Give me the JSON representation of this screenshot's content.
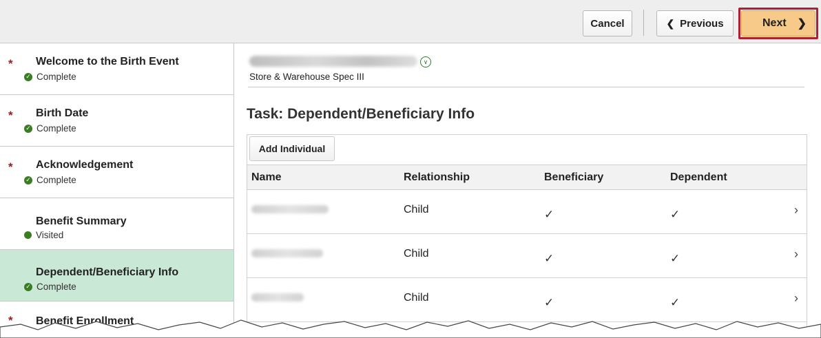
{
  "toolbar": {
    "cancel_label": "Cancel",
    "previous_label": "Previous",
    "next_label": "Next"
  },
  "sidebar": {
    "steps": [
      {
        "title": "Welcome to the Birth Event",
        "status": "Complete",
        "required": "*"
      },
      {
        "title": "Birth Date",
        "status": "Complete",
        "required": "*"
      },
      {
        "title": "Acknowledgement",
        "status": "Complete",
        "required": "*"
      },
      {
        "title": "Benefit Summary",
        "status": "Visited",
        "required": ""
      },
      {
        "title": "Dependent/Beneficiary Info",
        "status": "Complete",
        "required": "",
        "active": true
      },
      {
        "title": "Benefit Enrollment",
        "status": "",
        "required": "*"
      }
    ]
  },
  "employee": {
    "job_title": "Store & Warehouse Spec III"
  },
  "task": {
    "title": "Task: Dependent/Beneficiary Info",
    "add_button_label": "Add Individual"
  },
  "table": {
    "columns": [
      "Name",
      "Relationship",
      "Beneficiary",
      "Dependent"
    ],
    "rows": [
      {
        "relationship": "Child",
        "beneficiary": "✓",
        "dependent": "✓"
      },
      {
        "relationship": "Child",
        "beneficiary": "✓",
        "dependent": "✓"
      },
      {
        "relationship": "Child",
        "beneficiary": "✓",
        "dependent": "✓"
      }
    ]
  },
  "colors": {
    "accent_next": "#f7ca8a",
    "highlight_outline": "#b01e2f",
    "active_step": "#c9e8d6",
    "status_green": "#3a7d23",
    "required_red": "#9b1c1c"
  }
}
